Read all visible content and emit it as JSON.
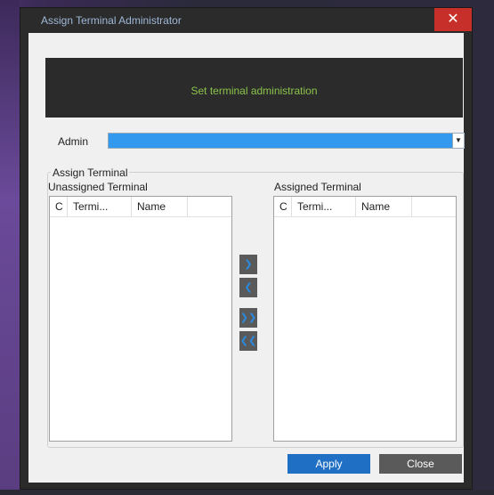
{
  "window": {
    "title": "Assign Terminal Administrator",
    "close_symbol": "✕"
  },
  "banner": {
    "text": "Set terminal administration"
  },
  "admin": {
    "label": "Admin",
    "selected_value": "",
    "dropdown_arrow": "▼"
  },
  "group": {
    "legend": "Assign Terminal"
  },
  "unassigned": {
    "title": "Unassigned Terminal",
    "columns": [
      "C",
      "Termi...",
      "Name"
    ],
    "rows": []
  },
  "assigned": {
    "title": "Assigned Terminal",
    "columns": [
      "C",
      "Termi...",
      "Name"
    ],
    "rows": []
  },
  "move_buttons": {
    "move_right": "❯",
    "move_left": "❮",
    "move_all_right": "❯❯",
    "move_all_left": "❮❮"
  },
  "footer": {
    "apply_label": "Apply",
    "close_label": "Close"
  },
  "colors": {
    "accent": "#3399ee",
    "apply": "#1f6fc5",
    "close": "#5a5a5a",
    "banner_text": "#8bc34a",
    "titlebar_close": "#c7302a"
  }
}
